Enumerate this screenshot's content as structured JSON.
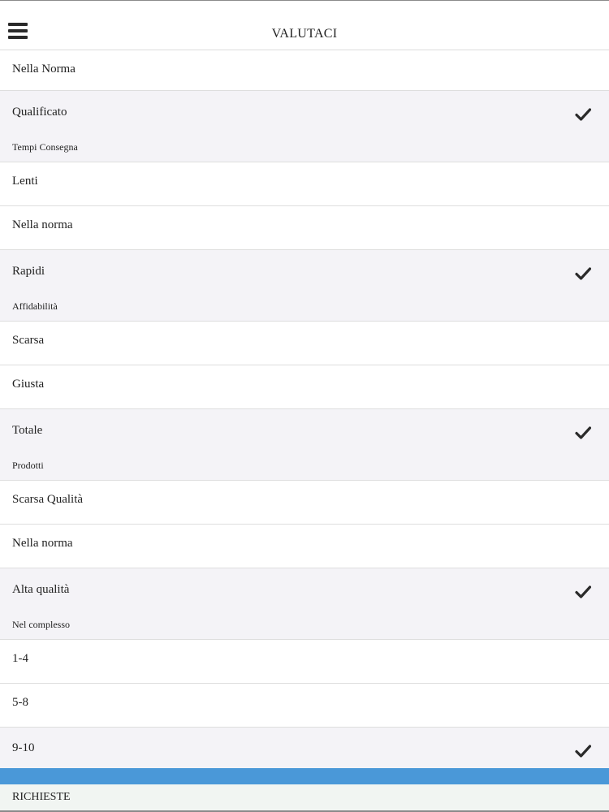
{
  "header": {
    "title": "VALUTACI",
    "menu_icon": "hamburger-menu-icon"
  },
  "sections": [
    {
      "options": [
        {
          "label": "Nella Norma",
          "selected": false
        },
        {
          "label": "Qualificato",
          "selected": true
        }
      ]
    },
    {
      "title": "Tempi Consegna",
      "options": [
        {
          "label": "Lenti",
          "selected": false
        },
        {
          "label": "Nella norma",
          "selected": false
        },
        {
          "label": "Rapidi",
          "selected": true
        }
      ]
    },
    {
      "title": "Affidabilità",
      "options": [
        {
          "label": "Scarsa",
          "selected": false
        },
        {
          "label": "Giusta",
          "selected": false
        },
        {
          "label": "Totale",
          "selected": true
        }
      ]
    },
    {
      "title": "Prodotti",
      "options": [
        {
          "label": "Scarsa Qualità",
          "selected": false
        },
        {
          "label": "Nella norma",
          "selected": false
        },
        {
          "label": "Alta qualità",
          "selected": true
        }
      ]
    },
    {
      "title": "Nel complesso",
      "options": [
        {
          "label": "1-4",
          "selected": false
        },
        {
          "label": "5-8",
          "selected": false
        },
        {
          "label": "9-10",
          "selected": true
        }
      ]
    }
  ],
  "footer": {
    "label": "RICHIESTE"
  },
  "colors": {
    "accent_bar": "#4a98d8",
    "selected_row": "#f4f3f7",
    "footer_bg": "#f1f5f2"
  },
  "icons": {
    "selected": "checkmark-icon"
  }
}
